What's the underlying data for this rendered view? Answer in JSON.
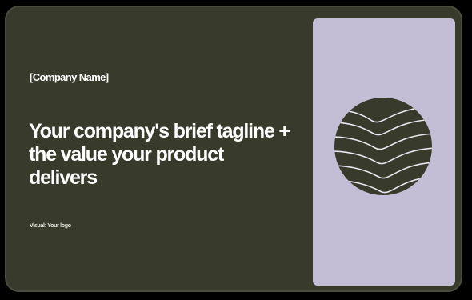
{
  "card": {
    "company_name": "[Company Name]",
    "tagline": "Your company's brief tagline + the value your product delivers",
    "logo_label": "Visual: Your logo"
  },
  "colors": {
    "card_background": "#383b2b",
    "panel_background": "#c3bdd5",
    "text": "#ffffff"
  },
  "icons": {
    "emblem": "wave-circle-icon"
  }
}
